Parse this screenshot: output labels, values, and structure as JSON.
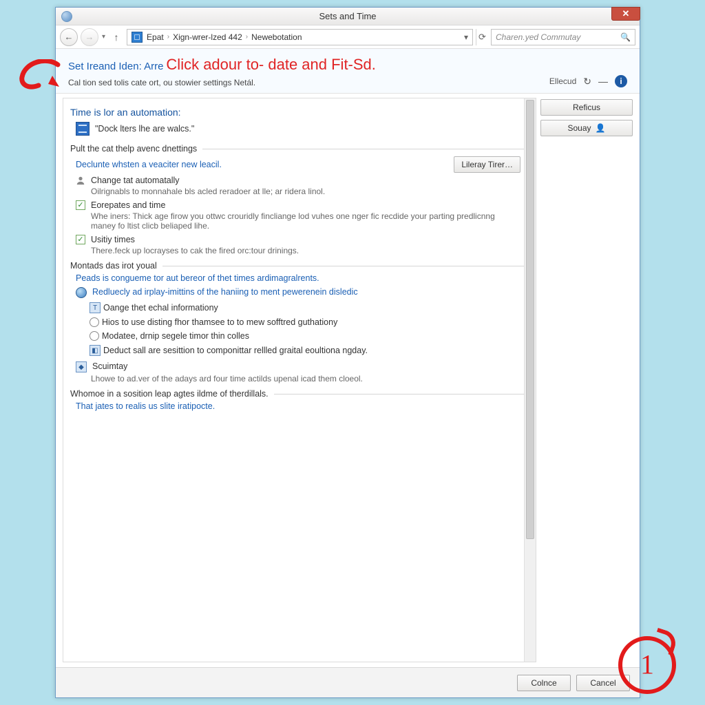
{
  "titlebar": {
    "title": "Sets and Time",
    "close": "✕"
  },
  "nav": {
    "breadcrumb": [
      "Epat",
      "Xign-wrer-lzed 442",
      "Newebotation"
    ],
    "search_placeholder": "Charen.yed Commutay"
  },
  "header": {
    "link_prefix": "Set Ireand Iden: Arre",
    "overlay": "Click adour to- date and Fit-Sd.",
    "subtitle": "Cal tion sed tolis cate ort, ou stowier settings Netál.",
    "tool_label": "Ellecud"
  },
  "side": {
    "btn1": "Reficus",
    "btn2": "Souay"
  },
  "content": {
    "sec1_title": "Time is lor an automation:",
    "sec1_quote": "\"Dock lters lhe are walcs.\"",
    "group1_title": "Pult the cat thelp avenc dnettings",
    "group1_link": "Declunte whsten a veaciter new leacil.",
    "group1_btn": "Lileray Tirer…",
    "item1_label": "Change tat automatally",
    "item1_desc": "Oilrignabls to monnahale bls acled reradoer at lle; ar ridera linol.",
    "item2_label": "Eorepates and time",
    "item2_desc": "Whe iners: Thick age firow you ottwc crouridly fincliange lod vuhes one nger fic recdide your parting predlicnng maney fo ltist clicb beliaped lihe.",
    "item3_label": "Usitiy times",
    "item3_desc": "There.feck up locrayses to cak the fired orc:tour drinings.",
    "group2_title": "Montads das irot youal",
    "group2_link": "Peads is congueme tor aut bereor of thet times ardimagralrents.",
    "radio_main": "Redluecly ad irplay-imittins of the haniing to ment pewerenein disledic",
    "radio_opt1": "Oange thet echal informationy",
    "radio_opt2": "Hios to use disting fhor thamsee to to mew sofftred guthationy",
    "radio_opt3": "Modatee, drnip segele timor thin colles",
    "radio_opt4": "Deduct sall are sesittion to componittar rellled graital eoultiona ngday.",
    "item4_label": "Scuimtay",
    "item4_desc": "Lhowe to ad.ver of the adays ard four time actilds upenal icad them cloeol.",
    "group3_title": "Whomoe in a sosition leap agtes ildme of therdillals.",
    "group3_link": "That jates to realis us slite iratipocte."
  },
  "footer": {
    "ok": "Colnce",
    "cancel": "Cancel"
  },
  "annotation": {
    "step_number": "1"
  }
}
